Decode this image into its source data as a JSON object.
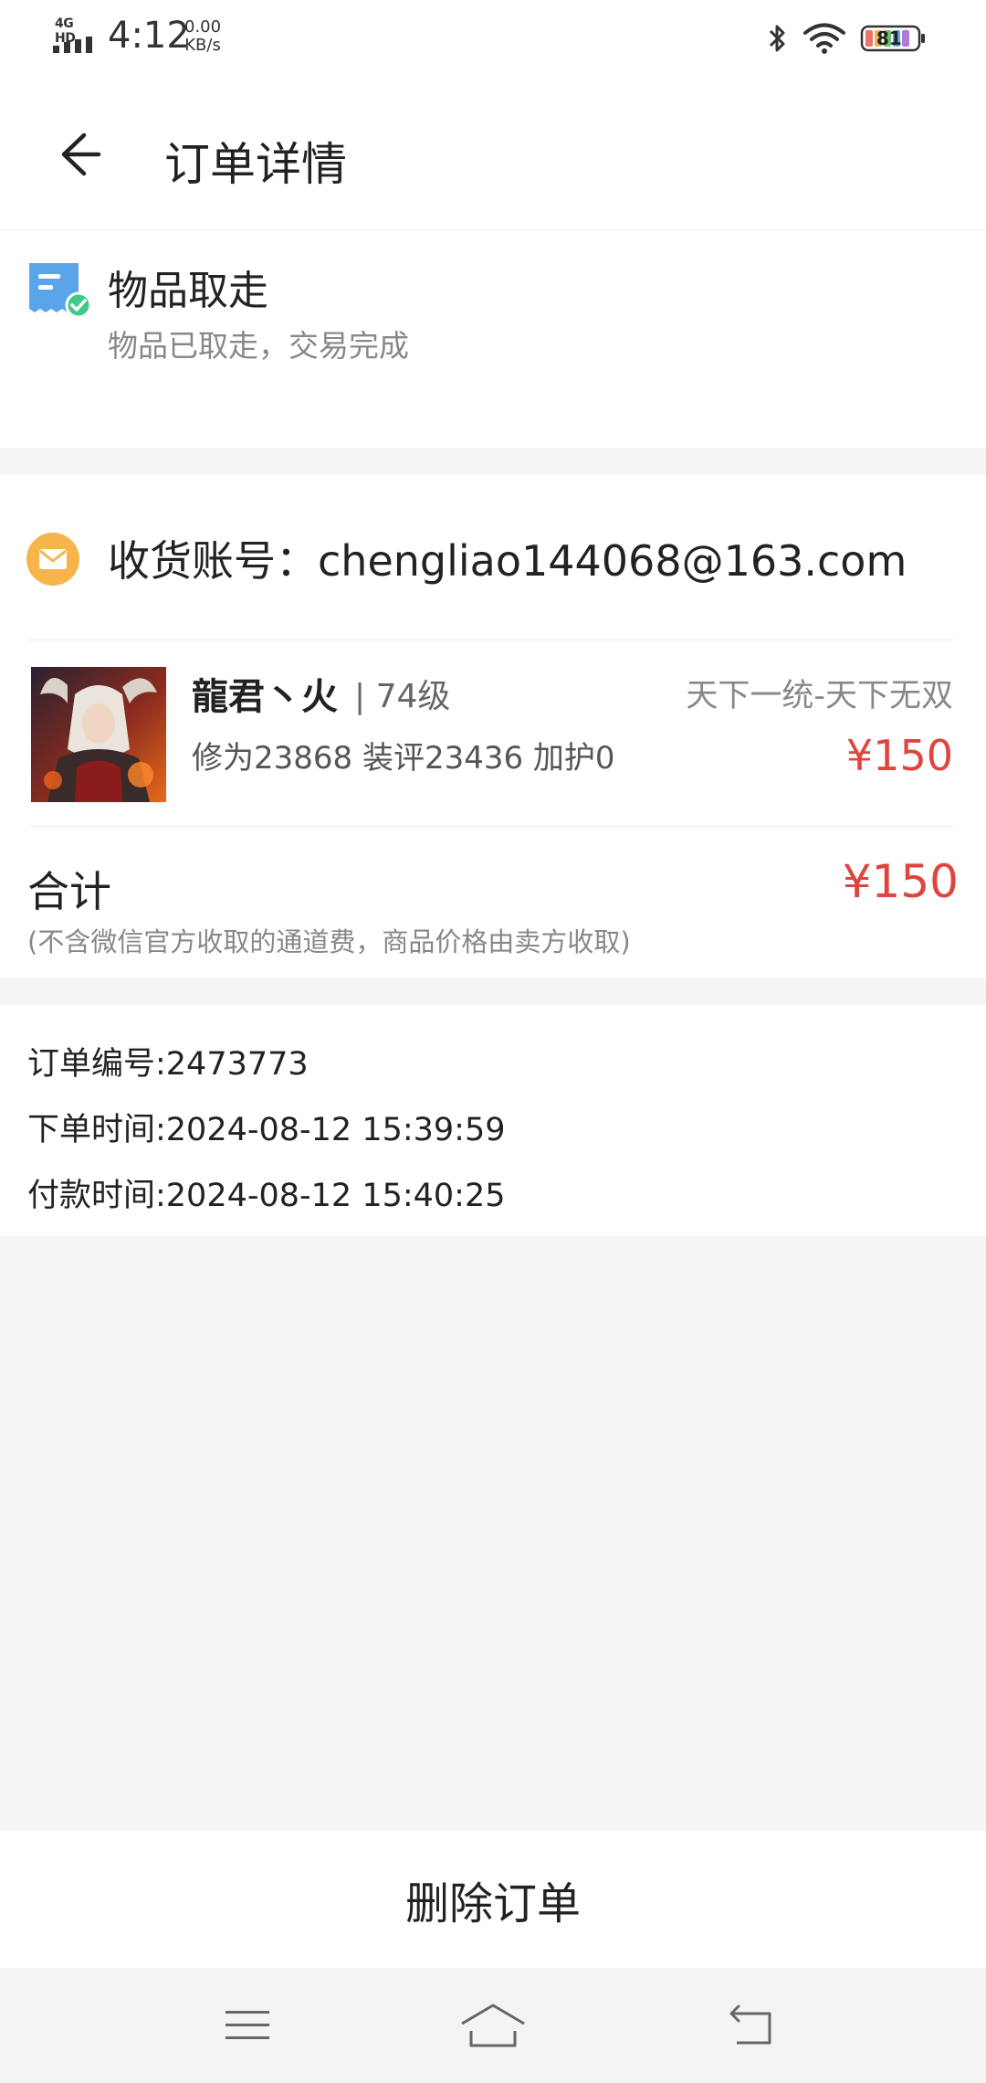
{
  "status_bar": {
    "network": "4G HD",
    "time": "4:12",
    "speed_value": "0.00",
    "speed_unit": "KB/s",
    "battery": "81"
  },
  "header": {
    "title": "订单详情"
  },
  "order_status": {
    "title": "物品取走",
    "description": "物品已取走，交易完成"
  },
  "order": {
    "account_label": "收货账号：chengliao144068@163.com",
    "item": {
      "name": "龍君丶火",
      "level": "| 74级",
      "server": "天下一统-天下无双",
      "stats": "修为23868 装评23436 加护0",
      "price": "¥150"
    },
    "total": {
      "label": "合计",
      "price": "¥150",
      "note": "(不含微信官方收取的通道费，商品价格由卖方收取)"
    }
  },
  "order_info": {
    "number": "订单编号:2473773",
    "order_time": "下单时间:2024-08-12 15:39:59",
    "pay_time": "付款时间:2024-08-12 15:40:25"
  },
  "actions": {
    "delete_label": "删除订单"
  },
  "colors": {
    "accent_price": "#e0443e",
    "status_icon": "#4a90e2",
    "mail_icon": "#f6b44b"
  }
}
